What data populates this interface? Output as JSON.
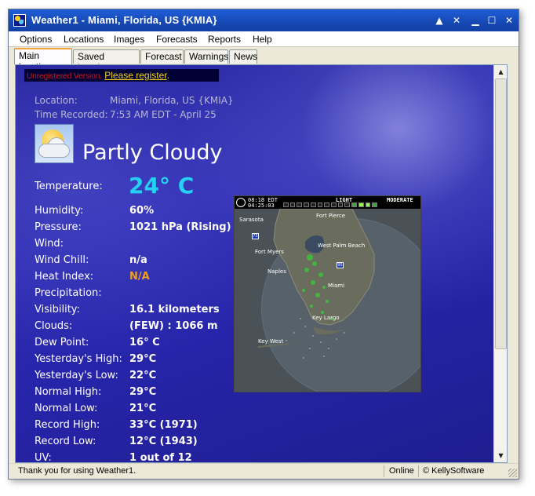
{
  "window": {
    "title": "Weather1 - Miami, Florida, US {KMIA}",
    "buttons": {
      "help": "▲",
      "close_small": "✕",
      "minimize": "▁",
      "maximize": "☐",
      "close": "✕"
    }
  },
  "menu": {
    "items": [
      "Options",
      "Locations",
      "Images",
      "Forecasts",
      "Reports",
      "Help"
    ]
  },
  "tabs": {
    "items": [
      "Main location",
      "Saved locations",
      "Forecast",
      "Warnings",
      "News"
    ],
    "active": "Main location"
  },
  "registration": {
    "notice": "Unregistered Version.",
    "link": "Please register",
    "dot": "."
  },
  "meta": {
    "location_label": "Location:",
    "location_value": "Miami, Florida, US {KMIA}",
    "time_label": "Time Recorded:",
    "time_value": "7:53 AM EDT - April 25"
  },
  "condition": {
    "text": "Partly Cloudy",
    "icon": "partly-cloudy-icon"
  },
  "temperature": {
    "label": "Temperature:",
    "value": "24° C"
  },
  "details": [
    {
      "label": "Humidity:",
      "value": "60%"
    },
    {
      "label": "Pressure:",
      "value": "1021 hPa (Rising)"
    },
    {
      "label": "Wind:",
      "value": ""
    },
    {
      "label": "Wind Chill:",
      "value": "n/a"
    },
    {
      "label": "Heat Index:",
      "value": "N/A",
      "color": "#f0a020"
    },
    {
      "label": "Precipitation:",
      "value": ""
    },
    {
      "label": "Visibility:",
      "value": "16.1 kilometers"
    },
    {
      "label": "Clouds:",
      "value": "(FEW) : 1066 m"
    },
    {
      "label": "Dew Point:",
      "value": "16° C"
    },
    {
      "label": "Yesterday's High:",
      "value": "29°C"
    },
    {
      "label": "Yesterday's Low:",
      "value": "22°C"
    },
    {
      "label": "Normal High:",
      "value": "29°C"
    },
    {
      "label": "Normal Low:",
      "value": "21°C"
    },
    {
      "label": "Record High:",
      "value": "33°C (1971)"
    },
    {
      "label": "Record Low:",
      "value": "12°C (1943)"
    },
    {
      "label": "UV:",
      "value": "1 out of 12"
    }
  ],
  "radar": {
    "time1": "08:18 EDT",
    "time2": "04:25:03",
    "scale_low": "LIGHT",
    "scale_high": "MODERATE",
    "cities": {
      "fort_pierce": "Fort Pierce",
      "sarasota": "Sarasota",
      "west_palm_beach": "West Palm Beach",
      "fort_myers": "Fort Myers",
      "naples": "Naples",
      "miami": "Miami",
      "key_largo": "Key Largo",
      "key_west": "Key West"
    },
    "highways": {
      "i75": "75",
      "i95": "95"
    }
  },
  "status": {
    "message": "Thank you for using Weather1.",
    "connection": "Online",
    "copyright": "© KellySoftware"
  },
  "colors": {
    "background": "#2624a8",
    "temperature": "#25d0f0",
    "heat_index": "#f0a020",
    "register_link": "#f0d020"
  }
}
